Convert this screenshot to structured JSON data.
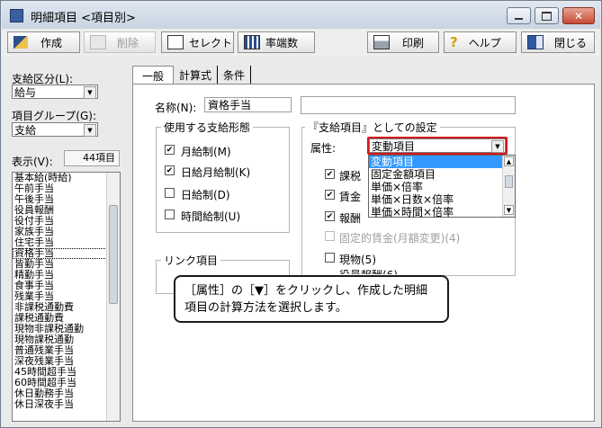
{
  "window": {
    "title": "明細項目 <項目別>"
  },
  "toolbar": {
    "create": "作成",
    "delete": "削除",
    "select": "セレクト",
    "rate": "率端数",
    "print": "印刷",
    "help": "ヘルプ",
    "close": "閉じる"
  },
  "left": {
    "pay_class_label": "支給区分(L):",
    "pay_class_value": "給与",
    "item_group_label": "項目グループ(G):",
    "item_group_value": "支給",
    "display_label": "表示(V):",
    "display_count": "44項目",
    "items": [
      "基本給(時給)",
      "午前手当",
      "午後手当",
      "役員報酬",
      "役付手当",
      "家族手当",
      "住宅手当",
      "資格手当",
      "皆勤手当",
      "精勤手当",
      "食事手当",
      "残業手当",
      "非課税通勤費",
      "課税通勤費",
      "現物非課税通勤",
      "現物課税通勤",
      "普通残業手当",
      "深夜残業手当",
      "45時間超手当",
      "60時間超手当",
      "休日勤務手当",
      "休日深夜手当"
    ]
  },
  "tabs": [
    "一般",
    "計算式",
    "条件"
  ],
  "general": {
    "name_label": "名称(N):",
    "name_value": "資格手当",
    "pay_forms_title": "使用する支給形態",
    "pay_forms": [
      {
        "label": "月給制(M)",
        "checked": true
      },
      {
        "label": "日給月給制(K)",
        "checked": true
      },
      {
        "label": "日給制(D)",
        "checked": false
      },
      {
        "label": "時間給制(U)",
        "checked": false
      }
    ],
    "link_title": "リンク項目",
    "settings_title": "『支給項目』としての設定",
    "attr_label": "属性:",
    "attr_value": "変動項目",
    "attr_options": [
      "変動項目",
      "固定金額項目",
      "単価×倍率",
      "単価×日数×倍率",
      "単価×時間×倍率"
    ],
    "settings_checks": [
      {
        "label": "課税",
        "checked": true
      },
      {
        "label": "賃金",
        "checked": true
      },
      {
        "label": "報酬",
        "checked": true
      }
    ],
    "fixed_wage": "固定的賃金(月額変更)(4)",
    "inkind": "現物(5)",
    "exec_comp": "役員報酬(6)"
  },
  "callout": "［属性］の［▼］をクリックし、作成した明細項目の計算方法を選択します。",
  "colors": {
    "highlight": "#3399ff",
    "red_frame": "#d9141b"
  }
}
